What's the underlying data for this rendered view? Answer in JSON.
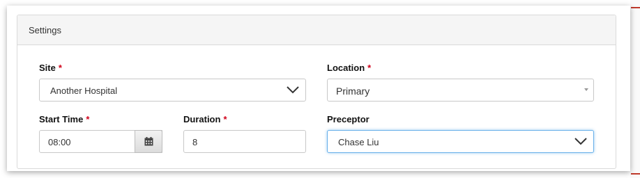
{
  "panel": {
    "title": "Settings"
  },
  "required_mark": "*",
  "fields": {
    "site": {
      "label": "Site",
      "value": "Another Hospital",
      "required": true
    },
    "location": {
      "label": "Location",
      "value": "Primary",
      "required": true
    },
    "start_time": {
      "label": "Start Time",
      "value": "08:00",
      "required": true
    },
    "duration": {
      "label": "Duration",
      "value": "8",
      "required": true
    },
    "preceptor": {
      "label": "Preceptor",
      "value": "Chase Liu",
      "required": false
    }
  },
  "icons": {
    "calendar": "calendar-icon",
    "dropdown": "chevron-down-icon"
  },
  "colors": {
    "required": "#d0021b",
    "focus": "#66afe9"
  }
}
